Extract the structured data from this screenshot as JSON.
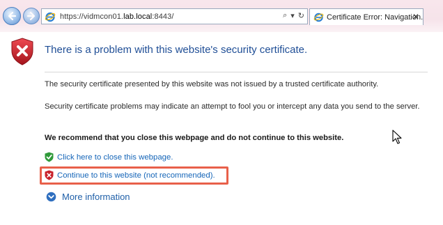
{
  "browser": {
    "url_prefix": "https://vidmcon01.",
    "url_domain": "lab.local",
    "url_suffix": ":8443/",
    "address_tools": {
      "search": "⌕",
      "dropdown": "▾",
      "refresh": "↻"
    },
    "tab_title": "Certificate Error: Navigation...",
    "tab_close": "✕"
  },
  "page": {
    "title": "There is a problem with this website's security certificate.",
    "paragraph_1": "The security certificate presented by this website was not issued by a trusted certificate authority.",
    "paragraph_2": "Security certificate problems may indicate an attempt to fool you or intercept any data you send to the server.",
    "recommendation": "We recommend that you close this webpage and do not continue to this website.",
    "close_link": "Click here to close this webpage.",
    "continue_link": "Continue to this website (not recommended).",
    "more_info": "More information"
  },
  "colors": {
    "title": "#1f4e96",
    "link": "#1565b8",
    "highlight_border": "#e8604a",
    "shield_red": "#c8222b",
    "shield_green": "#2f9a3a"
  },
  "icons": {
    "back": "back-arrow-icon",
    "forward": "forward-arrow-icon",
    "site": "ie-logo-icon",
    "error_shield": "red-shield-x-icon",
    "safe_shield": "green-shield-check-icon",
    "more": "chevron-circle-down-icon",
    "cursor": "mouse-pointer-icon"
  }
}
